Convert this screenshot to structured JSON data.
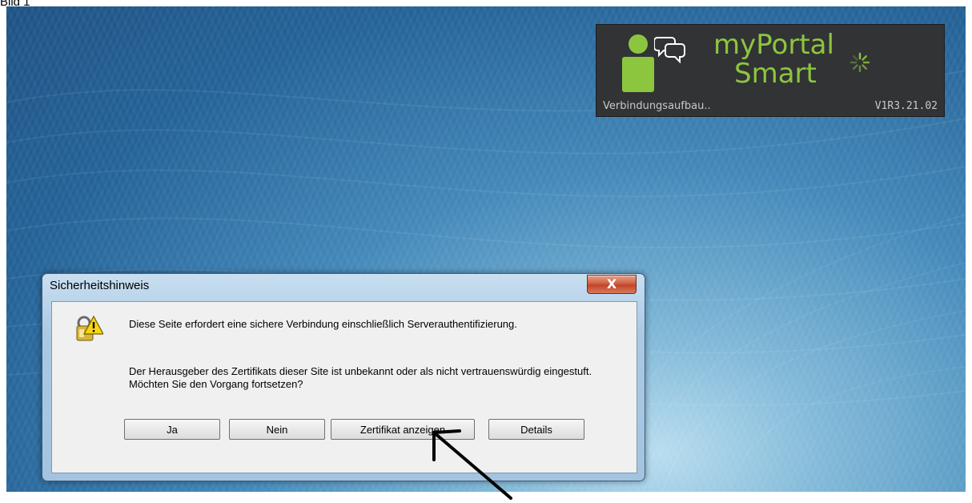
{
  "caption": "Bild 1",
  "widget": {
    "brand_line1": "myPortal",
    "brand_line2": "Smart",
    "status": "Verbindungsaufbau..",
    "version": "V1R3.21.02",
    "brand_color": "#8cc63f",
    "icons": [
      "user-avatar-icon",
      "chat-bubbles-icon",
      "loading-spinner-icon"
    ]
  },
  "dialog": {
    "title": "Sicherheitshinweis",
    "close_label": "X",
    "message1": "Diese Seite erfordert eine sichere Verbindung einschließlich Serverauthentifizierung.",
    "message2": "Der Herausgeber des Zertifikats dieser Site ist unbekannt oder als nicht vertrauenswürdig eingestuft. Möchten Sie den Vorgang fortsetzen?",
    "icon": "security-warning-lock-icon",
    "buttons": {
      "yes": "Ja",
      "no": "Nein",
      "view_certificate": "Zertifikat anzeigen",
      "details": "Details"
    }
  },
  "annotation": {
    "icon": "arrow-pointer-icon",
    "color": "#000000"
  }
}
